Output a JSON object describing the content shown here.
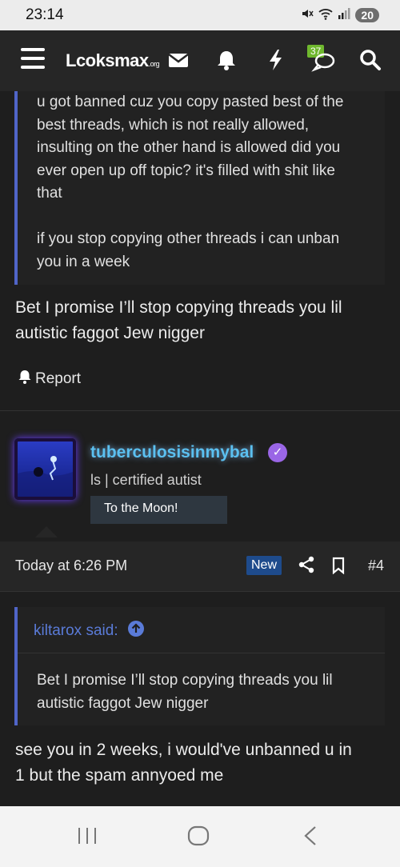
{
  "status_bar": {
    "time": "23:14",
    "battery": "20",
    "icons": [
      "mute-icon",
      "wifi-icon",
      "signal-icon"
    ]
  },
  "nav": {
    "logo": "Lcoksmax",
    "logo_suffix": ".org",
    "notification_count": "37",
    "icons": [
      "hamburger-icon",
      "mail-icon",
      "bell-icon",
      "lightning-icon",
      "chat-icon",
      "search-icon"
    ]
  },
  "post1": {
    "quote_lines": [
      "u got banned cuz you copy pasted best of the",
      "best threads, which is not really allowed,",
      "insulting on the other hand is allowed did you",
      "ever open up off topic? it's filled with shit like",
      "that",
      "",
      "if you stop copying other threads i can unban",
      "you in a week"
    ],
    "reply_lines": [
      "Bet I promise I’ll stop copying threads you lil",
      "autistic faggot Jew nigger"
    ],
    "report_label": "Report"
  },
  "post2": {
    "username": "tuberculosisinmybal",
    "user_title": "ls | certified autist",
    "banner": "To the Moon!",
    "timestamp": "Today at 6:26 PM",
    "new_label": "New",
    "post_number": "#4",
    "quote_author": "kiltarox said:",
    "quote_lines": [
      "Bet I promise I’ll stop copying threads you lil",
      "autistic faggot Jew nigger"
    ],
    "reply_lines": [
      "see you in 2 weeks, i would've unbanned u in",
      "1 but the spam annyoed me"
    ]
  },
  "colors": {
    "background": "#1e1e1e",
    "quote_border": "#5065c8",
    "username": "#5bc0f0",
    "quote_author": "#5a7bd8",
    "badge_green": "#6fb82e",
    "new_badge": "#1e4b8c",
    "verified": "#9a66e6"
  }
}
